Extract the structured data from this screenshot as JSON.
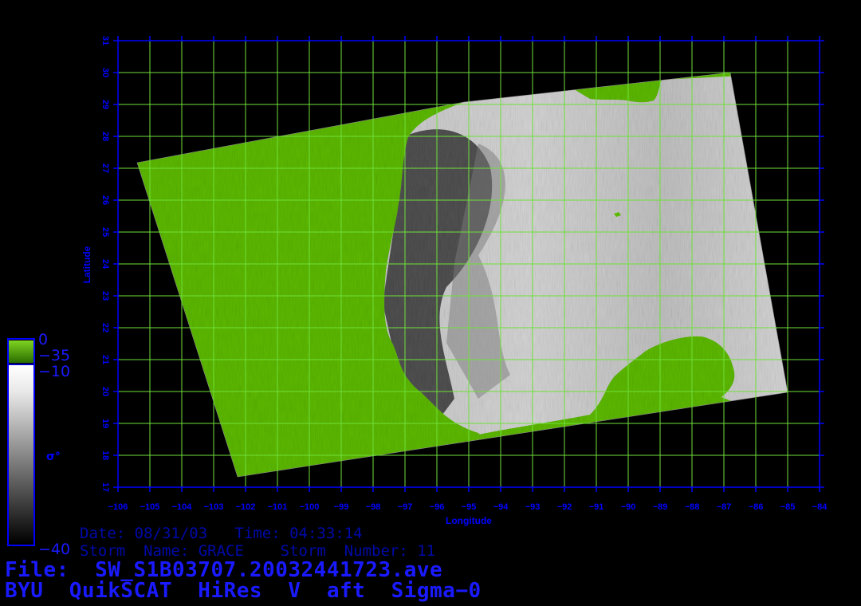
{
  "map": {
    "x_axis_label": "Longitude",
    "y_axis_label": "Latitude",
    "lon_range": [
      -106,
      -84
    ],
    "lat_range": [
      17,
      31
    ],
    "lon_ticks": [
      "-106",
      "-105",
      "-104",
      "-103",
      "-102",
      "-101",
      "-100",
      "-99",
      "-98",
      "-97",
      "-96",
      "-95",
      "-94",
      "-93",
      "-92",
      "-91",
      "-90",
      "-89",
      "-88",
      "-87",
      "-86",
      "-85",
      "-84"
    ],
    "lat_ticks": [
      "17",
      "18",
      "19",
      "20",
      "21",
      "22",
      "23",
      "24",
      "25",
      "26",
      "27",
      "28",
      "29",
      "30",
      "31"
    ],
    "grid": true,
    "colors": {
      "background": "#000000",
      "axis": "#0000ff",
      "grid": "#6fe03a",
      "land": "#5cb800",
      "ocean_light": "#c8c8c8",
      "ocean_dark": "#3a3a3a"
    }
  },
  "colorbar": {
    "label": "σ°",
    "land_top": "0",
    "land_bottom": "−35",
    "sigma_top": "−10",
    "sigma_bottom": "−40"
  },
  "info": {
    "line1": "Date: 08/31/03   Time: 04:33:14",
    "line2": "Storm  Name: GRACE    Storm  Number: 11"
  },
  "file_line": "File:  SW_S1B03707.20032441723.ave",
  "title_line": "BYU  QuikSCAT  HiRes  V  aft  Sigma−0"
}
